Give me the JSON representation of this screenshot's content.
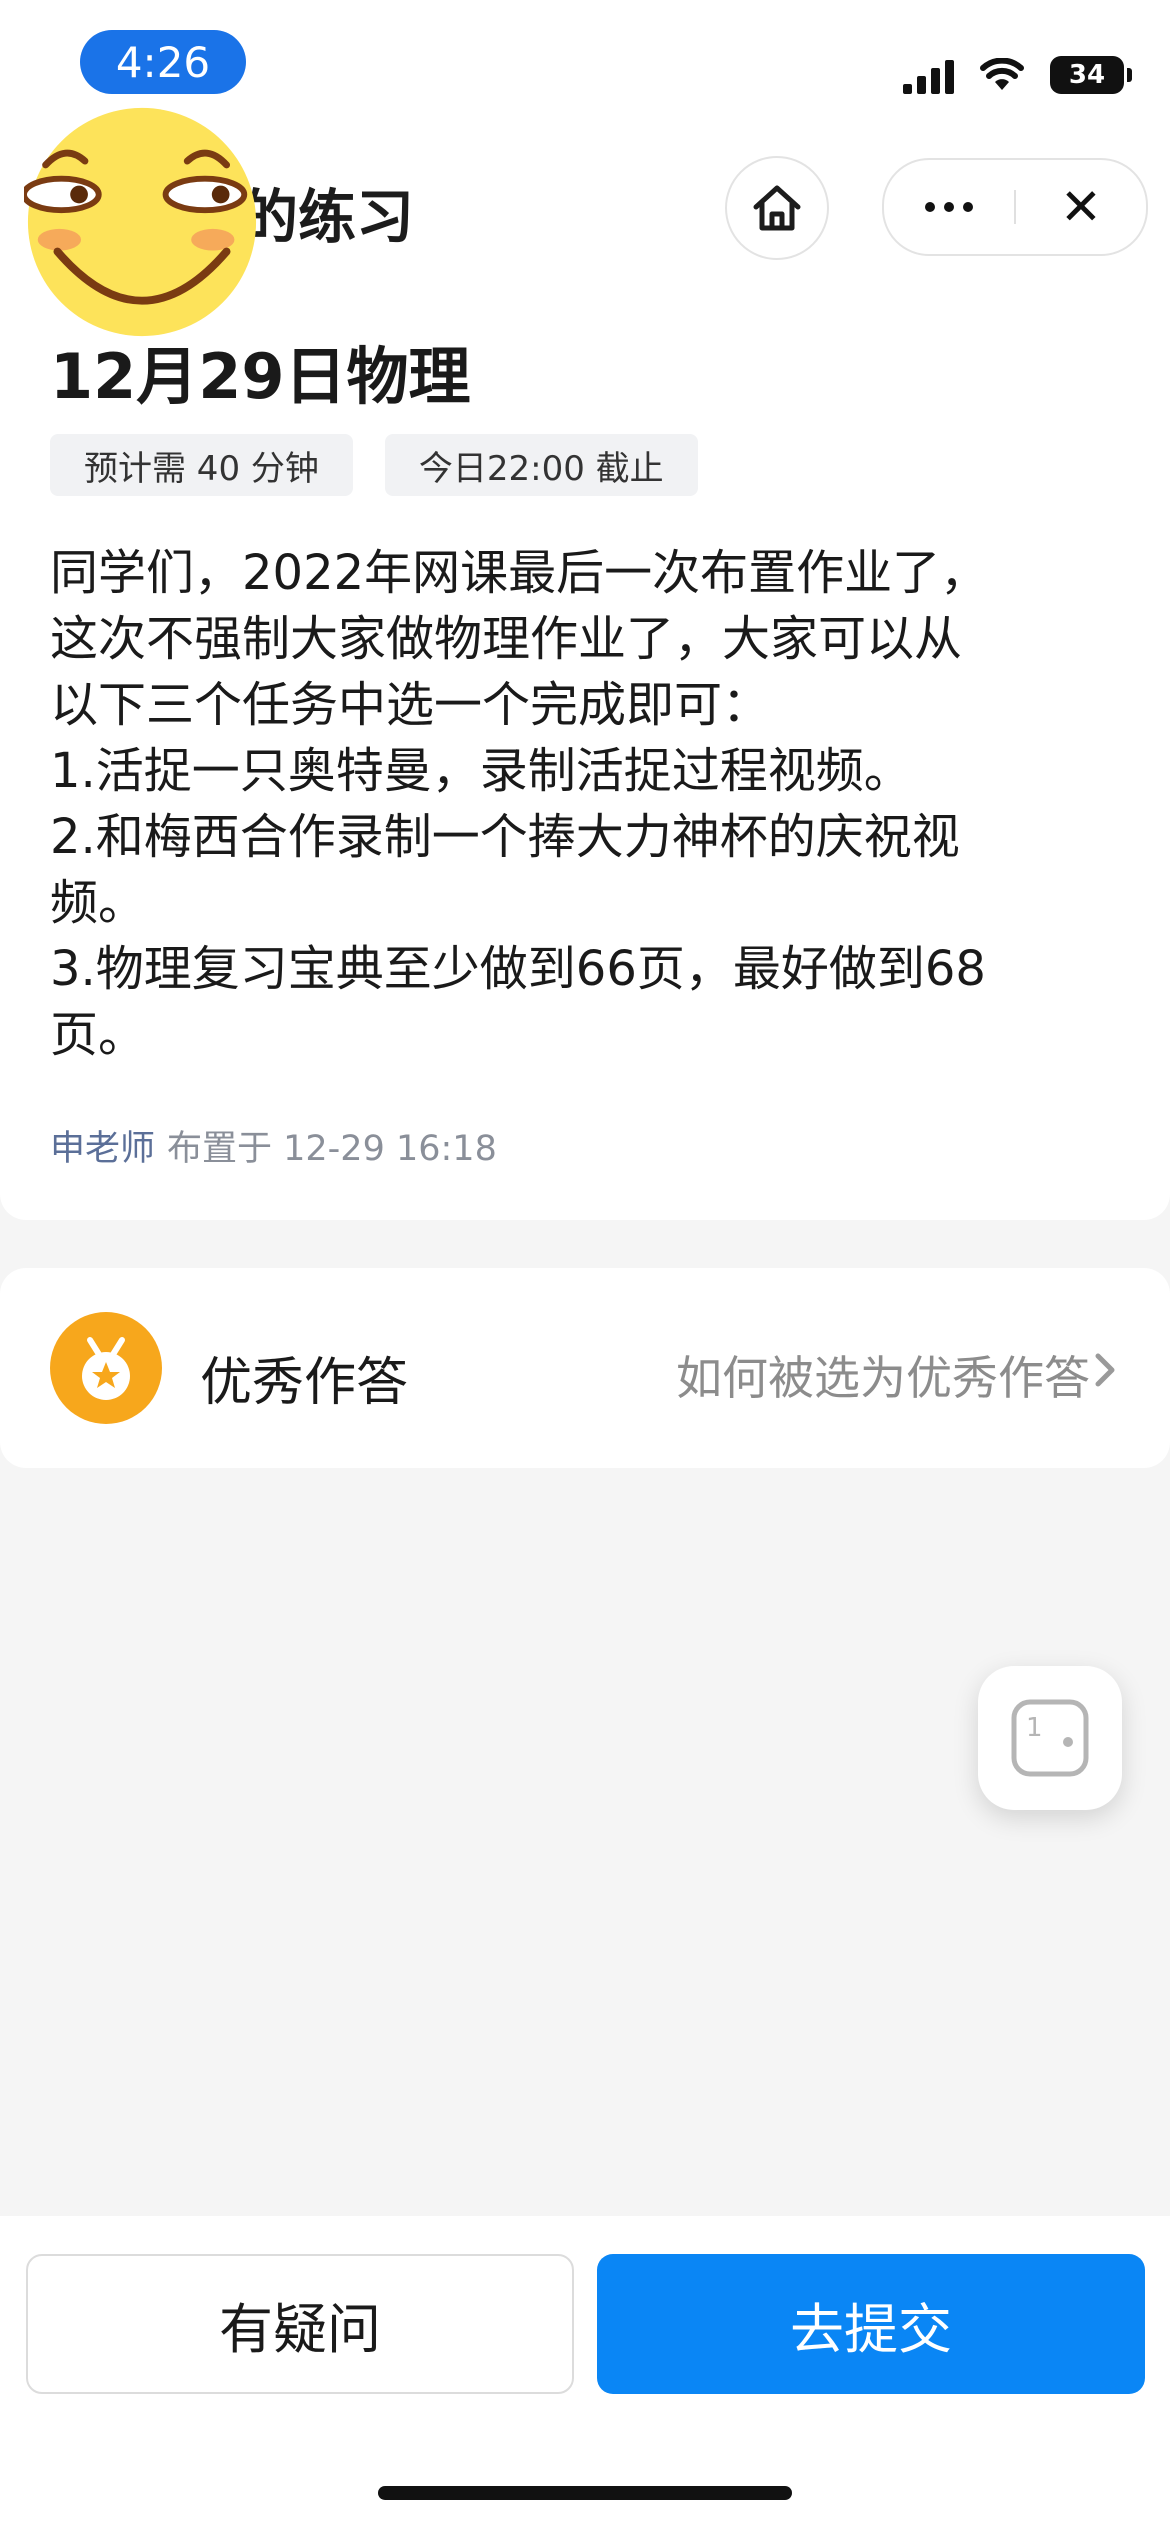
{
  "status_bar": {
    "time": "4:26",
    "battery": "34"
  },
  "nav": {
    "title": "的练习",
    "close_symbol": "✕"
  },
  "homework": {
    "title": "12月29日物理",
    "tags": [
      "预计需 40 分钟",
      "今日22:00 截止"
    ],
    "description_lines": [
      "同学们，2022年网课最后一次布置作业了，",
      "这次不强制大家做物理作业了，大家可以从",
      "以下三个任务中选一个完成即可：",
      "1.活捉一只奥特曼，录制活捉过程视频。",
      "2.和梅西合作录制一个捧大力神杯的庆祝视",
      "频。",
      "3.物理复习宝典至少做到66页，最好做到68",
      "页。"
    ],
    "teacher": "申老师",
    "assigned_at": "布置于 12-29 16:18"
  },
  "excellent": {
    "title": "优秀作答",
    "link": "如何被选为优秀作答"
  },
  "float_button": {
    "label": "1"
  },
  "actions": {
    "question": "有疑问",
    "submit": "去提交"
  },
  "colors": {
    "primary": "#0a86f5",
    "time_pill": "#1a73e8",
    "medal": "#f7a71c",
    "teacher": "#5b6f98"
  }
}
